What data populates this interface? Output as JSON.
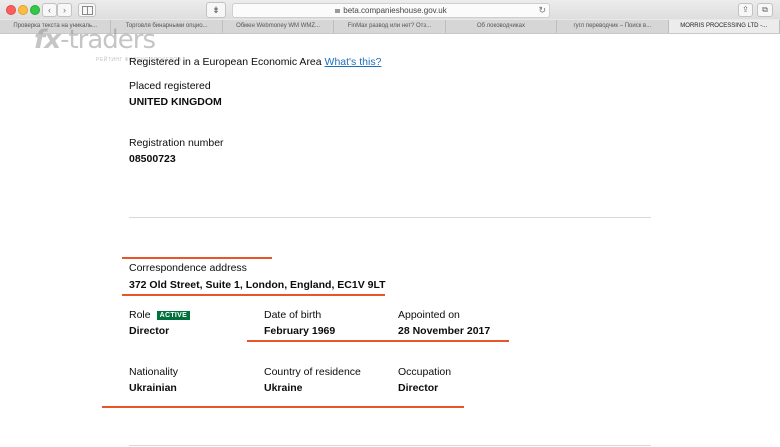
{
  "browser": {
    "url": "beta.companieshouse.gov.uk",
    "tabs": [
      {
        "label": "Проверка текста на уникаль...",
        "active": false
      },
      {
        "label": "Торговля бинарными опцио...",
        "active": false
      },
      {
        "label": "Обмен Webmoney WM WMZ...",
        "active": false
      },
      {
        "label": "FinMax развод или нет? Отз...",
        "active": false
      },
      {
        "label": "Об лоководчиках",
        "active": false
      },
      {
        "label": "гугл переводчик – Поиск в...",
        "active": false
      },
      {
        "label": "MORRIS PROCESSING LTD -...",
        "active": true
      }
    ]
  },
  "watermark": {
    "brand_fx": "fx",
    "brand_rest": "-traders",
    "tagline": "РЕЙТИНГ ФОРЕКС БРОКЕРОВ"
  },
  "registration": {
    "eea_text": "Registered in a European Economic Area",
    "eea_link": "What's this?",
    "place_label": "Placed registered",
    "place_value": "UNITED KINGDOM",
    "number_label": "Registration number",
    "number_value": "08500723"
  },
  "officer": {
    "address_label": "Correspondence address",
    "address_value": "372 Old Street, Suite 1, London, England, EC1V 9LT",
    "role_label": "Role",
    "role_badge": "ACTIVE",
    "role_value": "Director",
    "dob_label": "Date of birth",
    "dob_value": "February 1969",
    "appointed_label": "Appointed on",
    "appointed_value": "28 November 2017",
    "nationality_label": "Nationality",
    "nationality_value": "Ukrainian",
    "residence_label": "Country of residence",
    "residence_value": "Ukraine",
    "occupation_label": "Occupation",
    "occupation_value": "Director"
  },
  "colors": {
    "accent_red": "#e8552b",
    "link_blue": "#1d70b8",
    "badge_green": "#00703c"
  }
}
